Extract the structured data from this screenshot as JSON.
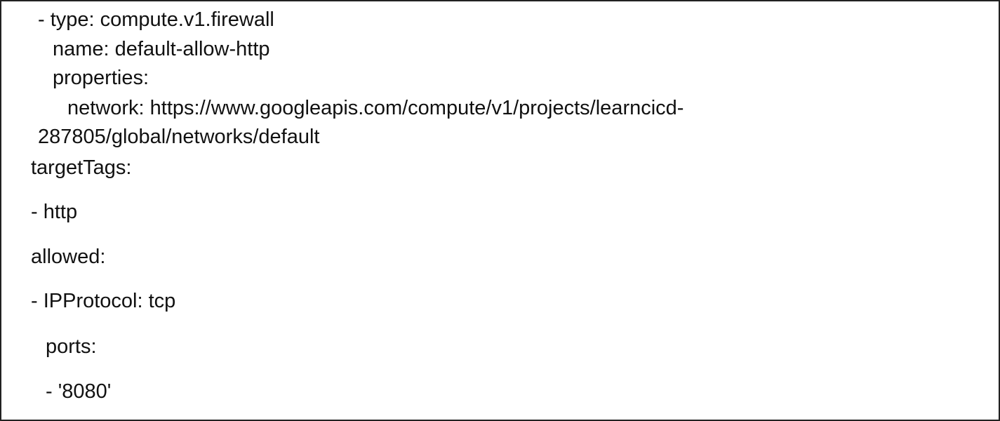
{
  "document": {
    "lines": [
      "- type: compute.v1.firewall",
      "name: default-allow-http",
      "properties:",
      "network: https://www.googleapis.com/compute/v1/projects/learncicd-",
      "287805/global/networks/default",
      "targetTags:",
      "- http",
      "allowed:",
      "- IPProtocol: tcp",
      "ports:",
      "- '8080'"
    ]
  }
}
